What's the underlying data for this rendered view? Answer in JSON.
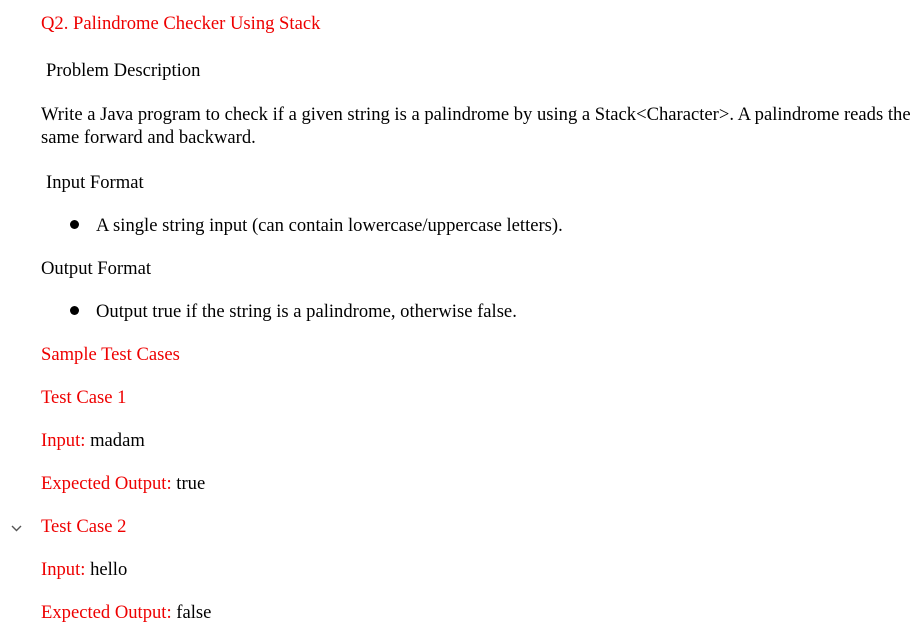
{
  "question_title": "Q2. Palindrome Checker Using Stack",
  "problem": {
    "heading": "Problem Description",
    "text": "Write a Java program to check if a given string is a palindrome by using a Stack<Character>. A palindrome reads the same forward and backward."
  },
  "input_format": {
    "heading": "Input Format",
    "bullets": [
      "A single string input (can contain lowercase/uppercase letters)."
    ]
  },
  "output_format": {
    "heading": "Output Format",
    "bullets": [
      "Output true if the string is a palindrome, otherwise false."
    ]
  },
  "sample": {
    "heading": "Sample Test Cases",
    "cases": [
      {
        "title": "Test Case 1",
        "input_label": "Input:",
        "input_value": "madam",
        "output_label": "Expected Output:",
        "output_value": "true"
      },
      {
        "title": "Test Case 2",
        "input_label": "Input:",
        "input_value": "hello",
        "output_label": "Expected Output:",
        "output_value": "false"
      }
    ]
  },
  "colors": {
    "accent": "#ee0000",
    "text": "#000000",
    "chevron": "#555555"
  },
  "icons": {
    "collapse": "chevron-down-icon"
  }
}
